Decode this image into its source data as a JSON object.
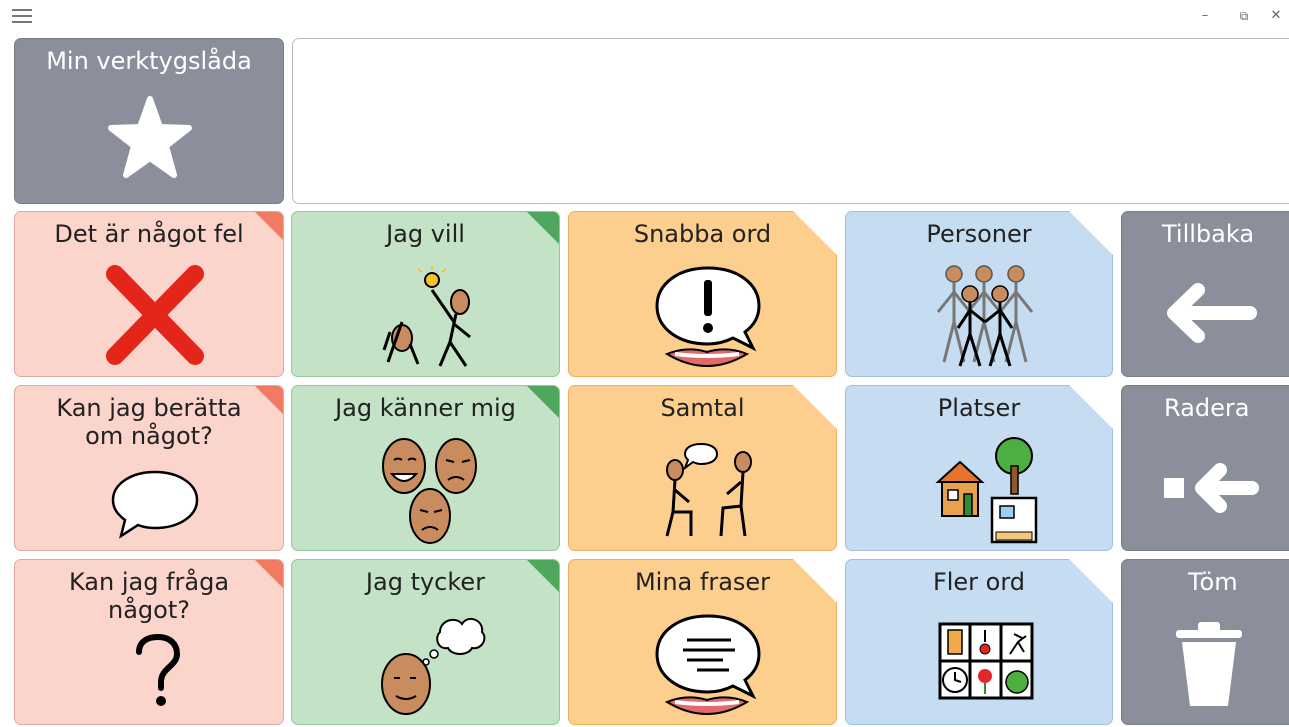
{
  "window": {
    "menu_icon": "hamburger-menu-icon",
    "minimize_glyph": "–",
    "restore_glyph": "⧉",
    "close_glyph": "✕"
  },
  "toolbox": {
    "label": "Min verktygslåda",
    "icon": "star-icon"
  },
  "message_bar": {
    "text": ""
  },
  "tiles": {
    "det_ar_nagot_fel": {
      "label": "Det är något fel",
      "icon": "red-cross-icon",
      "color": "#fbd4cc"
    },
    "kan_jag_beratta": {
      "label": "Kan jag berätta\nom något?",
      "icon": "speech-bubble-icon",
      "color": "#fbd4cc"
    },
    "kan_jag_fraga": {
      "label": "Kan jag fråga\nnågot?",
      "icon": "question-mark-icon",
      "color": "#fbd4cc"
    },
    "jag_vill": {
      "label": "Jag vill",
      "icon": "want-icon",
      "color": "#c3e2c6"
    },
    "jag_kanner_mig": {
      "label": "Jag känner mig",
      "icon": "feeling-faces-icon",
      "color": "#c3e2c6"
    },
    "jag_tycker": {
      "label": "Jag tycker",
      "icon": "thinking-face-icon",
      "color": "#c3e2c6"
    },
    "snabba_ord": {
      "label": "Snabba ord",
      "icon": "exclamation-speech-icon",
      "color": "#fdcf8e"
    },
    "samtal": {
      "label": "Samtal",
      "icon": "conversation-icon",
      "color": "#fdcf8e"
    },
    "mina_fraser": {
      "label": "Mina fraser",
      "icon": "phrases-speech-icon",
      "color": "#fdcf8e"
    },
    "personer": {
      "label": "Personer",
      "icon": "people-icon",
      "color": "#c6dcf0"
    },
    "platser": {
      "label": "Platser",
      "icon": "places-icon",
      "color": "#c6dcf0"
    },
    "fler_ord": {
      "label": "Fler ord",
      "icon": "more-words-grid-icon",
      "color": "#c6dcf0"
    },
    "tillbaka": {
      "label": "Tillbaka",
      "icon": "back-arrow-icon",
      "color": "#8a8f9b"
    },
    "radera": {
      "label": "Radera",
      "icon": "delete-backspace-icon",
      "color": "#8a8f9b"
    },
    "tom": {
      "label": "Töm",
      "icon": "trash-can-icon",
      "color": "#8a8f9b"
    }
  },
  "colors": {
    "red_corner": "#f07a62",
    "green_corner": "#4ea75c",
    "skin": "#c98c5e"
  }
}
